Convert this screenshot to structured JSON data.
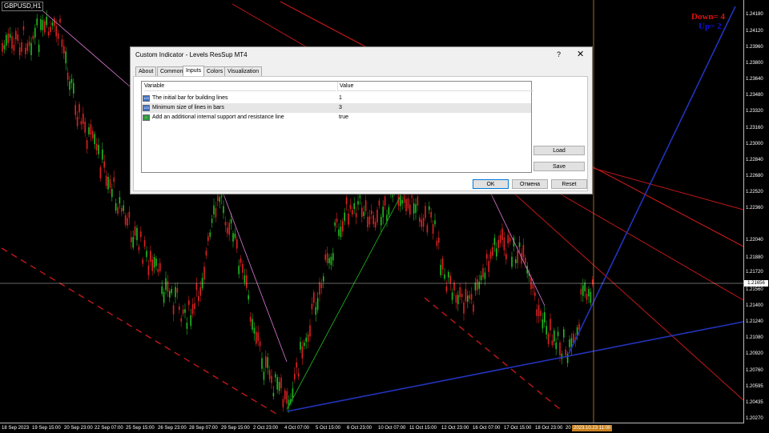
{
  "symbol": "GBPUSD,H1",
  "counters": {
    "down_label": "Down= 4",
    "up_label": "Up= 2",
    "down_color": "#dd1111",
    "up_color": "#1111dd"
  },
  "dialog": {
    "title": "Custom Indicator - Levels ResSup MT4",
    "help": "?",
    "close": "✕",
    "tabs": [
      "About",
      "Common",
      "Inputs",
      "Colors",
      "Visualization"
    ],
    "active_tab": "Inputs",
    "columns": [
      "Variable",
      "Value"
    ],
    "rows": [
      {
        "icon": "integer-param-icon",
        "variable": "The initial bar for building lines",
        "value": "1"
      },
      {
        "icon": "integer-param-icon",
        "variable": "Minimum size of lines in bars",
        "value": "3"
      },
      {
        "icon": "bool-param-icon",
        "variable": "Add an additional internal support and resistance line",
        "value": "true"
      }
    ],
    "buttons": {
      "load": "Load",
      "save": "Save",
      "ok": "OK",
      "cancel": "Отмена",
      "reset": "Reset"
    }
  },
  "price_axis": [
    "1.24180",
    "1.24120",
    "1.23960",
    "1.23800",
    "1.23640",
    "1.23480",
    "1.23320",
    "1.23160",
    "1.23000",
    "1.22840",
    "1.22680",
    "1.22520",
    "1.22360",
    "1.22040",
    "1.21880",
    "1.21720",
    "1.21560",
    "1.21400",
    "1.21240",
    "1.21080",
    "1.20920",
    "1.20760",
    "1.20595",
    "1.20435",
    "1.20270"
  ],
  "current_price": "1.21656",
  "time_axis": [
    "18 Sep 2023",
    "19 Sep 15:00",
    "20 Sep 23:00",
    "22 Sep 07:00",
    "25 Sep 15:00",
    "26 Sep 23:00",
    "28 Sep 07:00",
    "29 Sep 15:00",
    "2 Oct 23:00",
    "4 Oct 07:00",
    "5 Oct 15:00",
    "6 Oct 23:00",
    "10 Oct 07:00",
    "11 Oct 15:00",
    "12 Oct 23:00",
    "16 Oct 07:00",
    "17 Oct 15:00",
    "18 Oct 23:00",
    "20"
  ],
  "current_time": "2023.10.23 11:00",
  "colors": {
    "bull": "#22bb22",
    "bear": "#dd2222",
    "resistance": "#c01818",
    "support": "#2233bb",
    "internal_resistance": "#e07ad8",
    "internal_support": "#22bb22",
    "crosshair": "#d0d0d0",
    "time_marker": "#d08830"
  }
}
